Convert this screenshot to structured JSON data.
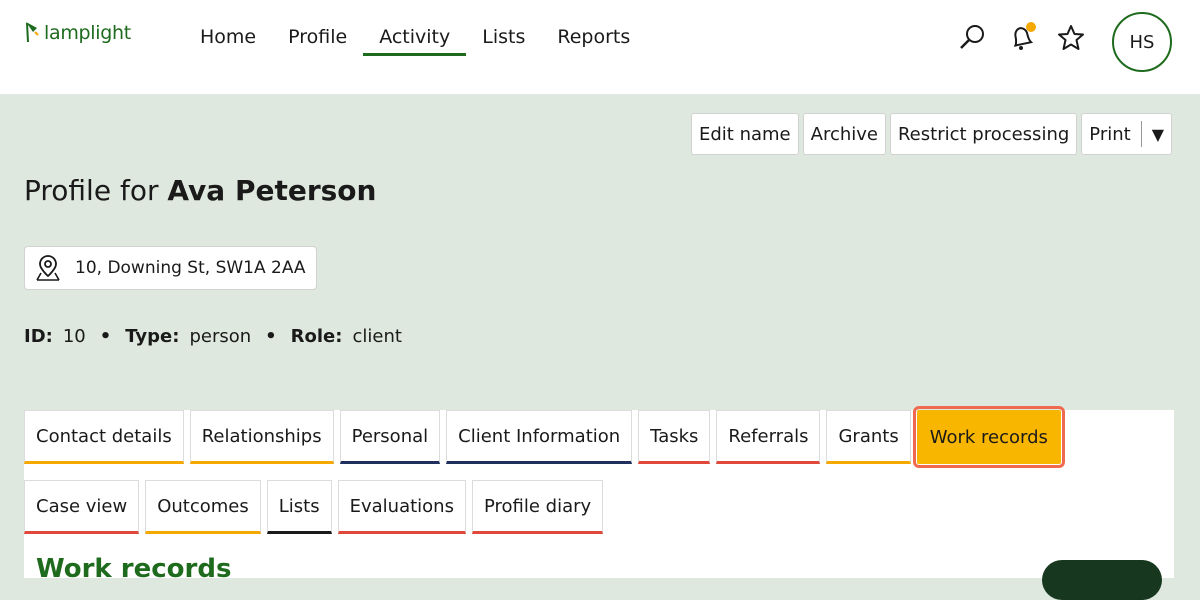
{
  "app": {
    "logo_text": "lamplight"
  },
  "nav": {
    "items": [
      {
        "label": "Home",
        "active": false
      },
      {
        "label": "Profile",
        "active": false
      },
      {
        "label": "Activity",
        "active": true
      },
      {
        "label": "Lists",
        "active": false
      },
      {
        "label": "Reports",
        "active": false
      }
    ]
  },
  "header_icons": {
    "search": "search-icon",
    "notifications": "bell-icon",
    "favorites": "star-icon",
    "user_initials": "HS"
  },
  "actions": {
    "edit_name": "Edit name",
    "archive": "Archive",
    "restrict_processing": "Restrict processing",
    "print": "Print",
    "print_caret": "▼"
  },
  "profile": {
    "title_prefix": "Profile for",
    "name": "Ava Peterson",
    "address": "10, Downing St, SW1A 2AA",
    "id_label": "ID:",
    "id_value": "10",
    "type_label": "Type:",
    "type_value": "person",
    "role_label": "Role:",
    "role_value": "client",
    "separator": "•"
  },
  "tabs_row1": [
    {
      "label": "Contact details",
      "color": "#f5a800",
      "active": false
    },
    {
      "label": "Relationships",
      "color": "#f5a800",
      "active": false
    },
    {
      "label": "Personal",
      "color": "#1f2f5e",
      "active": false
    },
    {
      "label": "Client Information",
      "color": "#1f2f5e",
      "active": false
    },
    {
      "label": "Tasks",
      "color": "#e0483a",
      "active": false
    },
    {
      "label": "Referrals",
      "color": "#e0483a",
      "active": false
    },
    {
      "label": "Grants",
      "color": "#f5a800",
      "active": false
    },
    {
      "label": "Work records",
      "color": "#f8b600",
      "active": true
    }
  ],
  "tabs_row2": [
    {
      "label": "Case view",
      "color": "#e0483a"
    },
    {
      "label": "Outcomes",
      "color": "#f5a800"
    },
    {
      "label": "Lists",
      "color": "#1a1a1a"
    },
    {
      "label": "Evaluations",
      "color": "#e0483a"
    },
    {
      "label": "Profile diary",
      "color": "#e0483a"
    }
  ],
  "section": {
    "heading": "Work records"
  },
  "colors": {
    "brand_green": "#1e6b1e",
    "accent_yellow": "#f8b600",
    "page_bg": "#dfe8df"
  }
}
